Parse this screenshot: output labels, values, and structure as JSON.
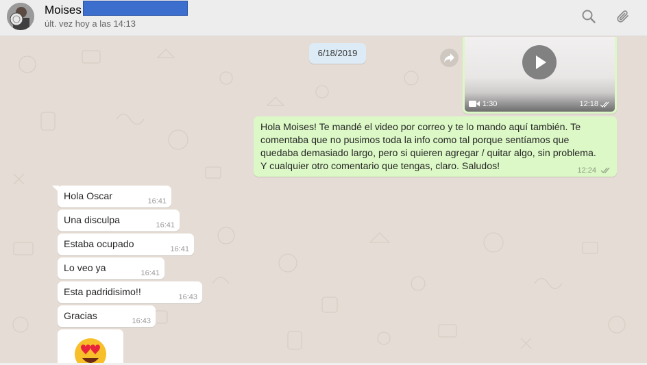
{
  "header": {
    "contact_name": "Moises",
    "last_seen": "últ. vez hoy a las 14:13",
    "icons": [
      "search-icon",
      "attach-icon"
    ]
  },
  "chat": {
    "date_separator": "6/18/2019",
    "video_message": {
      "duration": "1:30",
      "time": "12:18",
      "icons": [
        "play-icon",
        "video-camera-icon",
        "double-check-icon",
        "forward-icon"
      ]
    },
    "outgoing_message": {
      "lines": [
        "Hola Moises! Te mandé el video por correo y te lo mando aquí también. Te",
        "comentaba que no pusimos toda la info como tal porque sentíamos que",
        "quedaba demasiado largo, pero si quieren agregar / quitar algo, sin problema.",
        "Y cualquier otro comentario que tengas, claro. Saludos!"
      ],
      "time": "12:24"
    },
    "incoming_messages": [
      {
        "text": "Hola Oscar",
        "time": "16:41"
      },
      {
        "text": "Una disculpa",
        "time": "16:41"
      },
      {
        "text": "Estaba ocupado",
        "time": "16:41"
      },
      {
        "text": "Lo veo ya",
        "time": "16:41"
      },
      {
        "text": "Esta padridisimo!!",
        "time": "16:43"
      },
      {
        "text": "Gracias",
        "time": "16:43"
      }
    ],
    "emoji_message": {
      "emoji": "heart-eyes-emoji"
    }
  },
  "colors": {
    "chat_background": "#e5ddd5",
    "outgoing_bubble": "#dcf8c6",
    "incoming_bubble": "#ffffff",
    "date_pill": "#dcebf5",
    "redaction": "#3c6fcd"
  }
}
